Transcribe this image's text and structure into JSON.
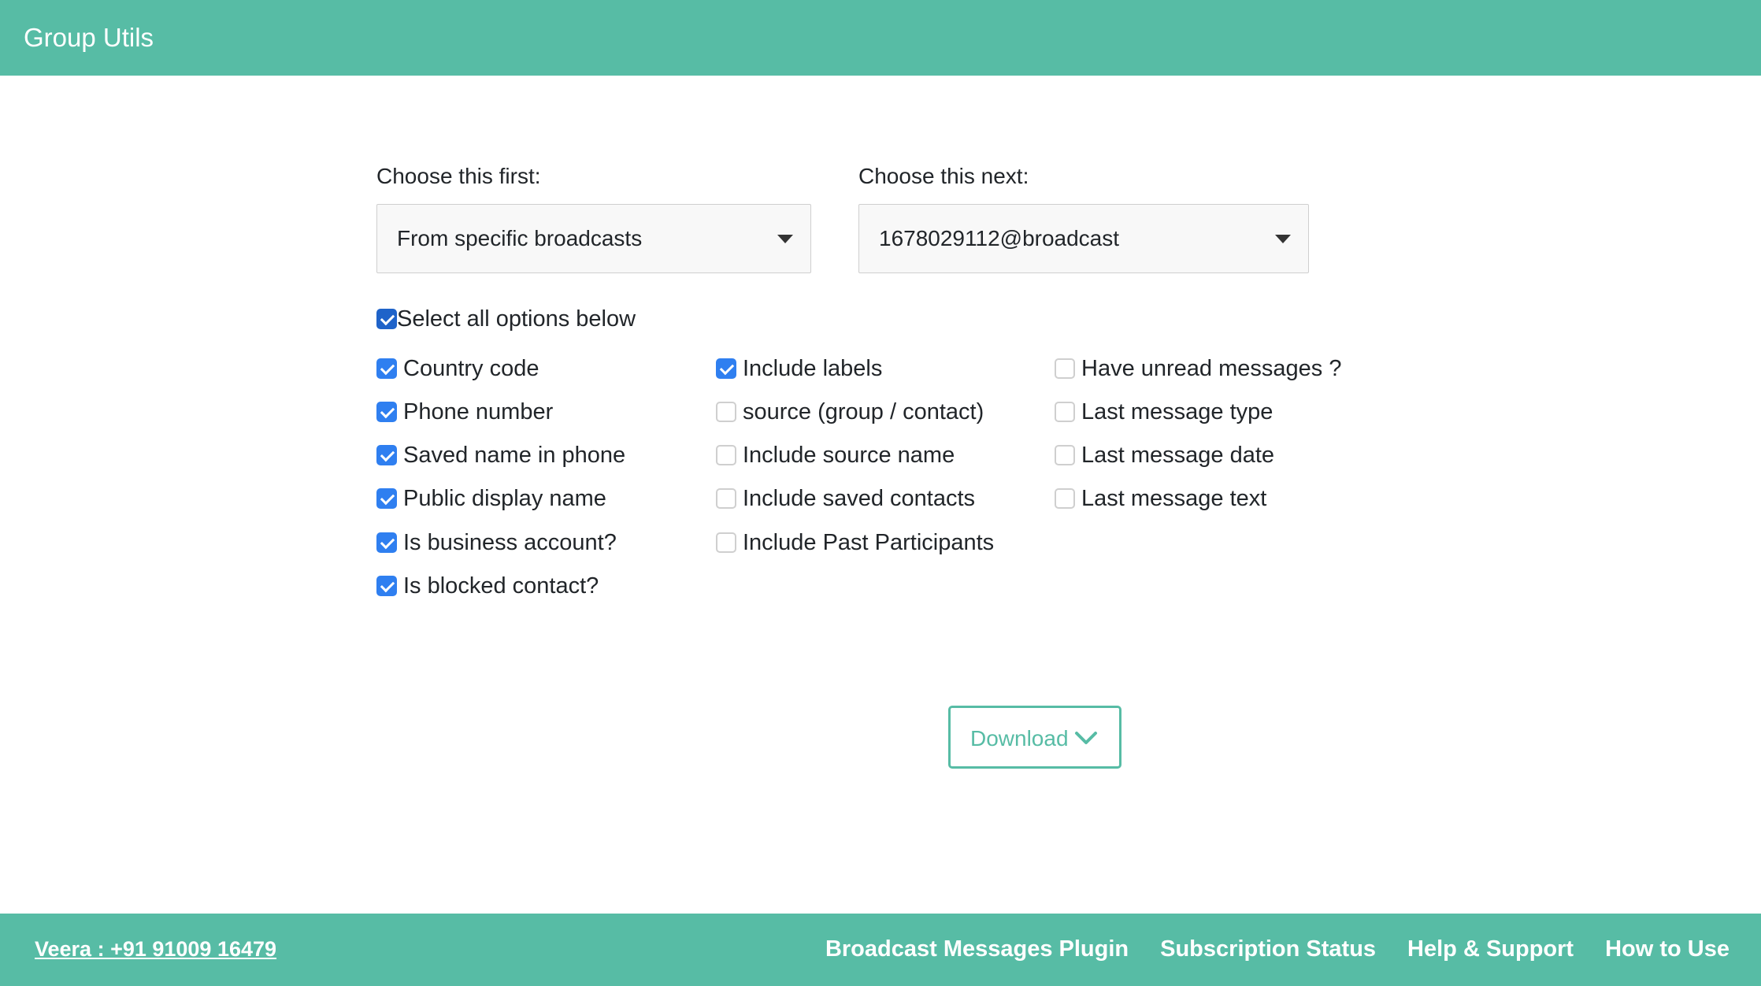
{
  "header": {
    "title": "Group Utils"
  },
  "form": {
    "first_label": "Choose this first:",
    "first_value": "From specific broadcasts",
    "next_label": "Choose this next:",
    "next_value": "1678029112@broadcast",
    "select_all_label": "Select all options below",
    "select_all_checked": true
  },
  "options": {
    "col1": [
      {
        "label": "Country code",
        "checked": true
      },
      {
        "label": "Phone number",
        "checked": true
      },
      {
        "label": "Saved name in phone",
        "checked": true
      },
      {
        "label": "Public display name",
        "checked": true
      },
      {
        "label": "Is business account?",
        "checked": true
      },
      {
        "label": "Is blocked contact?",
        "checked": true
      }
    ],
    "col2": [
      {
        "label": "Include labels",
        "checked": true
      },
      {
        "label": "source (group / contact)",
        "checked": false
      },
      {
        "label": "Include source name",
        "checked": false
      },
      {
        "label": "Include saved contacts",
        "checked": false
      },
      {
        "label": "Include Past Participants",
        "checked": false
      }
    ],
    "col3": [
      {
        "label": "Have unread messages ?",
        "checked": false
      },
      {
        "label": "Last message type",
        "checked": false
      },
      {
        "label": "Last message date",
        "checked": false
      },
      {
        "label": "Last message text",
        "checked": false
      }
    ]
  },
  "download": {
    "label": "Download",
    "icon": "chevron-down-icon"
  },
  "footer": {
    "contact": "Veera : +91 91009 16479",
    "links": [
      "Broadcast Messages Plugin",
      "Subscription Status",
      "Help & Support",
      "How to Use"
    ]
  },
  "colors": {
    "brand": "#57bca5",
    "checkbox_checked": "#2f7ff0"
  }
}
